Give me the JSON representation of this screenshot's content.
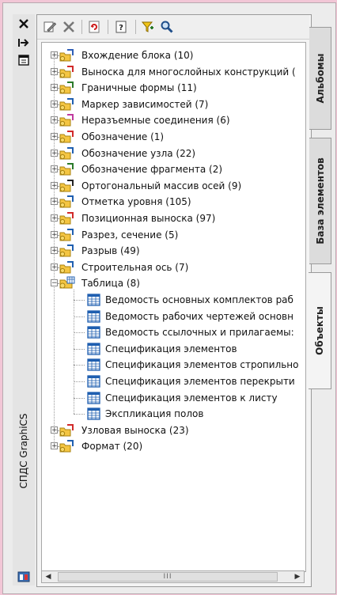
{
  "app": {
    "palette_title": "СПДС GraphiCS"
  },
  "strip_buttons": [
    {
      "name": "close-icon",
      "glyph": "✕"
    },
    {
      "name": "autohide-icon",
      "glyph": "⇥"
    },
    {
      "name": "properties-icon",
      "glyph": "▤"
    }
  ],
  "toolbar": [
    {
      "name": "edit-icon"
    },
    {
      "name": "delete-icon"
    },
    {
      "name": "refresh-icon"
    },
    {
      "name": "help-icon"
    },
    {
      "name": "filter-icon"
    },
    {
      "name": "search-icon"
    }
  ],
  "tabs": [
    {
      "label": "Альбомы",
      "active": false
    },
    {
      "label": "База элементов",
      "active": false
    },
    {
      "label": "Объекты",
      "active": true
    }
  ],
  "tree": {
    "items": [
      {
        "label": "Вхождение блока (10)",
        "icon": "block-icon",
        "expander": "+"
      },
      {
        "label": "Выноска для многослойных конструкций (",
        "icon": "multilayer-leader-icon",
        "expander": "+"
      },
      {
        "label": "Граничные формы (11)",
        "icon": "boundary-form-icon",
        "expander": "+"
      },
      {
        "label": "Маркер зависимостей (7)",
        "icon": "dependency-marker-icon",
        "expander": "+"
      },
      {
        "label": "Неразъемные соединения (6)",
        "icon": "permanent-joint-icon",
        "expander": "+"
      },
      {
        "label": "Обозначение (1)",
        "icon": "designation-icon",
        "expander": "+"
      },
      {
        "label": "Обозначение узла (22)",
        "icon": "node-designation-icon",
        "expander": "+"
      },
      {
        "label": "Обозначение фрагмента (2)",
        "icon": "fragment-designation-icon",
        "expander": "+"
      },
      {
        "label": "Ортогональный массив осей (9)",
        "icon": "axis-grid-icon",
        "expander": "+"
      },
      {
        "label": "Отметка уровня (105)",
        "icon": "level-mark-icon",
        "expander": "+"
      },
      {
        "label": "Позиционная выноска (97)",
        "icon": "position-leader-icon",
        "expander": "+"
      },
      {
        "label": "Разрез, сечение (5)",
        "icon": "section-cut-icon",
        "expander": "+"
      },
      {
        "label": "Разрыв (49)",
        "icon": "break-line-icon",
        "expander": "+"
      },
      {
        "label": "Строительная ось (7)",
        "icon": "building-axis-icon",
        "expander": "+"
      },
      {
        "label": "Таблица (8)",
        "icon": "table-folder-icon",
        "expander": "−"
      }
    ],
    "table_children": [
      {
        "label": "Ведомость основных комплектов раб"
      },
      {
        "label": "Ведомость рабочих чертежей основн"
      },
      {
        "label": "Ведомость ссылочных и прилагаемы:"
      },
      {
        "label": "Спецификация элементов"
      },
      {
        "label": "Спецификация элементов стропильно"
      },
      {
        "label": "Спецификация элементов перекрыти"
      },
      {
        "label": "Спецификация элементов к листу"
      },
      {
        "label": "Экспликация полов"
      }
    ],
    "tail_items": [
      {
        "label": "Узловая выноска (23)",
        "icon": "node-leader-icon",
        "expander": "+"
      },
      {
        "label": "Формат (20)",
        "icon": "format-icon",
        "expander": "+"
      }
    ]
  },
  "scrollbar": {
    "thumb_grip": "III"
  }
}
